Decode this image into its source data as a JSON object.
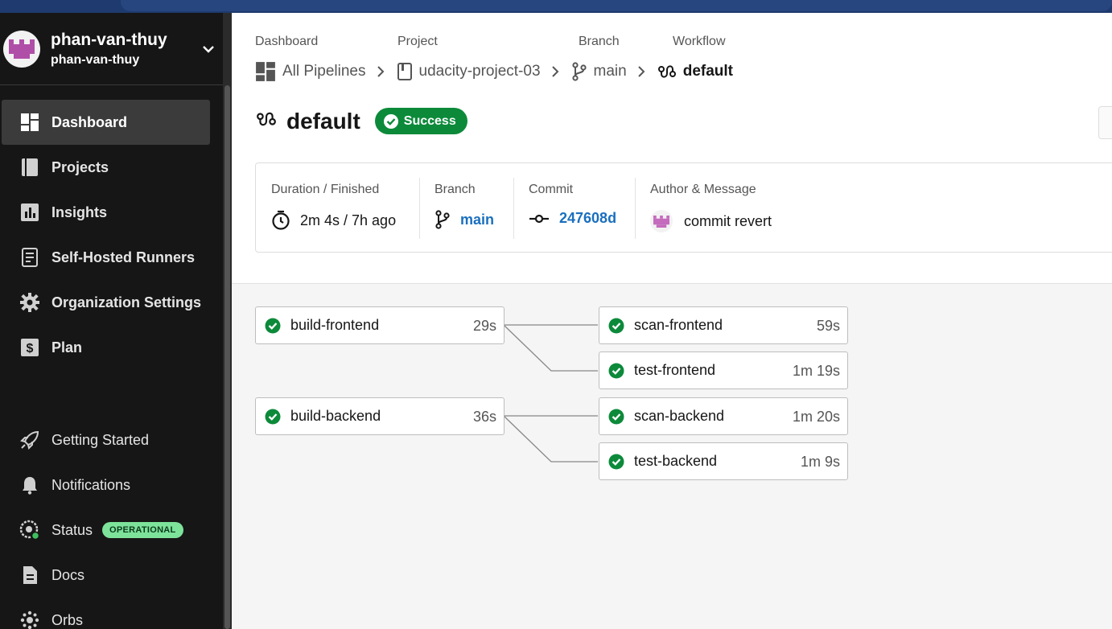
{
  "org": {
    "name": "phan-van-thuy",
    "sub": "phan-van-thuy"
  },
  "nav": {
    "primary": [
      {
        "label": "Dashboard",
        "icon": "dashboard-icon"
      },
      {
        "label": "Projects",
        "icon": "projects-icon"
      },
      {
        "label": "Insights",
        "icon": "insights-icon"
      },
      {
        "label": "Self-Hosted Runners",
        "icon": "runners-icon"
      },
      {
        "label": "Organization Settings",
        "icon": "gear-icon"
      },
      {
        "label": "Plan",
        "icon": "dollar-icon"
      }
    ],
    "secondary": [
      {
        "label": "Getting Started",
        "icon": "rocket-icon"
      },
      {
        "label": "Notifications",
        "icon": "bell-icon"
      },
      {
        "label": "Status",
        "icon": "status-icon",
        "badge": "OPERATIONAL"
      },
      {
        "label": "Docs",
        "icon": "docs-icon"
      },
      {
        "label": "Orbs",
        "icon": "orbs-icon"
      }
    ]
  },
  "breadcrumb": {
    "labels": {
      "dashboard": "Dashboard",
      "project": "Project",
      "branch": "Branch",
      "workflow": "Workflow"
    },
    "values": {
      "dashboard": "All Pipelines",
      "project": "udacity-project-03",
      "branch": "main",
      "workflow": "default"
    }
  },
  "workflow": {
    "title": "default",
    "status": "Success",
    "status_color": "#0c8a3a"
  },
  "info": {
    "duration_label": "Duration / Finished",
    "duration_value": "2m 4s / 7h ago",
    "branch_label": "Branch",
    "branch_value": "main",
    "commit_label": "Commit",
    "commit_value": "247608d",
    "author_label": "Author & Message",
    "author_message": "commit revert",
    "link_color": "#1a6fbf"
  },
  "jobs": [
    {
      "name": "build-frontend",
      "time": "29s",
      "status": "success"
    },
    {
      "name": "scan-frontend",
      "time": "59s",
      "status": "success"
    },
    {
      "name": "test-frontend",
      "time": "1m 19s",
      "status": "success"
    },
    {
      "name": "build-backend",
      "time": "36s",
      "status": "success"
    },
    {
      "name": "scan-backend",
      "time": "1m 20s",
      "status": "success"
    },
    {
      "name": "test-backend",
      "time": "1m 9s",
      "status": "success"
    }
  ]
}
